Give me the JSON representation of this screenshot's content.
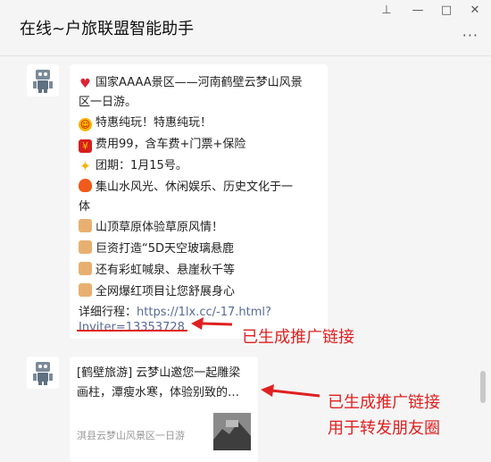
{
  "window": {
    "title": "在线~户旅联盟智能助手",
    "pin_label": "⊥",
    "minimize_label": "—",
    "maximize_label": "□",
    "close_label": "✕",
    "more_label": "···"
  },
  "messages": [
    {
      "type": "text",
      "lines": [
        {
          "icon": "heart-icon",
          "text": "国家AAAA景区——河南鹤壁云梦山风景"
        },
        {
          "icon": "",
          "text": "区一日游。"
        },
        {
          "icon": "grinning-face-icon",
          "text": "特惠纯玩！特惠纯玩！"
        },
        {
          "icon": "red-envelope-icon",
          "text": "费用99，含车费+门票+保险"
        },
        {
          "icon": "sparkle-star-icon",
          "text": "团期：1月15号。"
        },
        {
          "icon": "fire-icon",
          "text": "集山水风光、休闲娱乐、历史文化于一"
        },
        {
          "icon": "",
          "text": "体"
        },
        {
          "icon": "thumbs-up-icon",
          "text": "山顶草原体验草原风情！"
        },
        {
          "icon": "thumbs-up-icon",
          "text": "巨资打造“5D天空玻璃悬鹿"
        },
        {
          "icon": "thumbs-up-icon",
          "text": "还有彩虹喊泉、悬崖秋千等"
        },
        {
          "icon": "thumbs-up-icon",
          "text": "全网爆红项目让您舒展身心"
        }
      ],
      "detail_label": "详细行程：",
      "link_part1": "https://1lx.cc/-17.html?",
      "link_part2": "Inviter=13353728"
    },
    {
      "type": "link-card",
      "title": "[鹤壁旅游] 云梦山邀您一起雕梁画柱，潭瘦水寒，体验别致的…",
      "source": "淇县云梦山风景区一日游"
    }
  ],
  "annotations": {
    "first": "已生成推广链接",
    "second_line1": "已生成推广链接",
    "second_line2": "用于转发朋友圈"
  },
  "colors": {
    "annotation_red": "#e02020",
    "link_blue": "#576b95",
    "chat_bg": "#f5f5f5"
  }
}
